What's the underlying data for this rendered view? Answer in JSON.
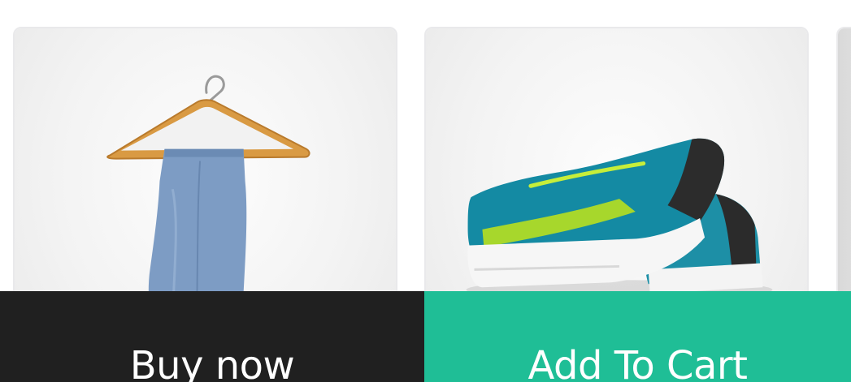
{
  "colors": {
    "buy_button_bg": "#202020",
    "cart_button_bg": "#1fbe96",
    "button_text": "#ffffff",
    "card_border": "#e9e9eb"
  },
  "products": [
    {
      "image_icon": "jeans-on-hanger-image"
    },
    {
      "image_icon": "sneakers-image"
    },
    {
      "image_icon": "partial-product-image"
    }
  ],
  "actions": {
    "buy_label": "Buy now",
    "cart_label": "Add To Cart"
  }
}
